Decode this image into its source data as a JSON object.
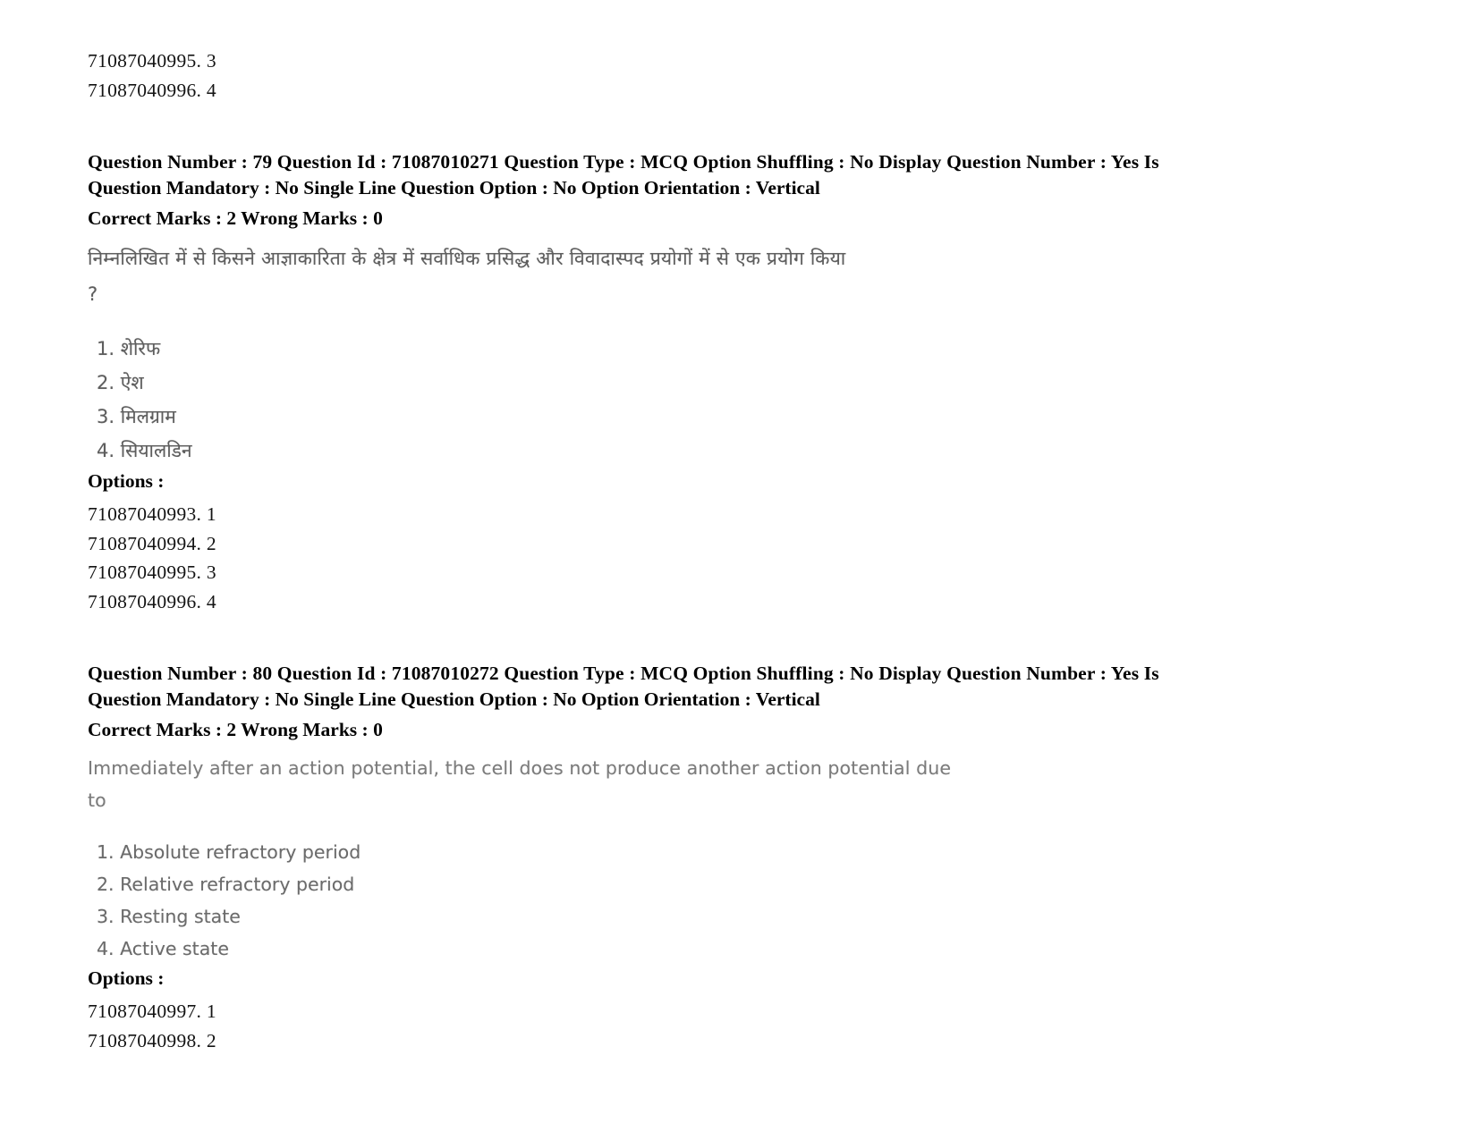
{
  "document": {
    "type": "exam-question-paper-scan",
    "background_color": "#ffffff",
    "text_color": "#000000",
    "faded_text_color": "#6b6b6b"
  },
  "top_fragment": {
    "option_ids": [
      "71087040995. 3",
      "71087040996. 4"
    ]
  },
  "questions": [
    {
      "header_line1": "Question Number : 79 Question Id : 71087010271 Question Type : MCQ Option Shuffling : No Display Question Number : Yes Is",
      "header_line2": "Question Mandatory : No Single Line Question Option : No Option Orientation : Vertical",
      "marks_line": "Correct Marks : 2 Wrong Marks : 0",
      "stem_line1": "निम्नलिखित में से किसने आज्ञाकारिता के क्षेत्र में सर्वाधिक प्रसिद्ध और विवादास्पद प्रयोगों में से एक प्रयोग किया",
      "stem_line2": "?",
      "choices": [
        "1. शेरिफ",
        "2. ऐश",
        "3. मिलग्राम",
        "4. सियालडिन"
      ],
      "options_label": "Options :",
      "option_ids": [
        "71087040993. 1",
        "71087040994. 2",
        "71087040995. 3",
        "71087040996. 4"
      ]
    },
    {
      "header_line1": "Question Number : 80 Question Id : 71087010272 Question Type : MCQ Option Shuffling : No Display Question Number : Yes Is",
      "header_line2": "Question Mandatory : No Single Line Question Option : No Option Orientation : Vertical",
      "marks_line": "Correct Marks : 2 Wrong Marks : 0",
      "stem_line1": "Immediately after an action potential, the cell does not produce another action potential due",
      "stem_line2": "to",
      "choices": [
        "1. Absolute refractory period",
        "2. Relative refractory period",
        "3. Resting state",
        "4. Active state"
      ],
      "options_label": "Options :",
      "option_ids": [
        "71087040997. 1",
        "71087040998. 2"
      ]
    }
  ]
}
